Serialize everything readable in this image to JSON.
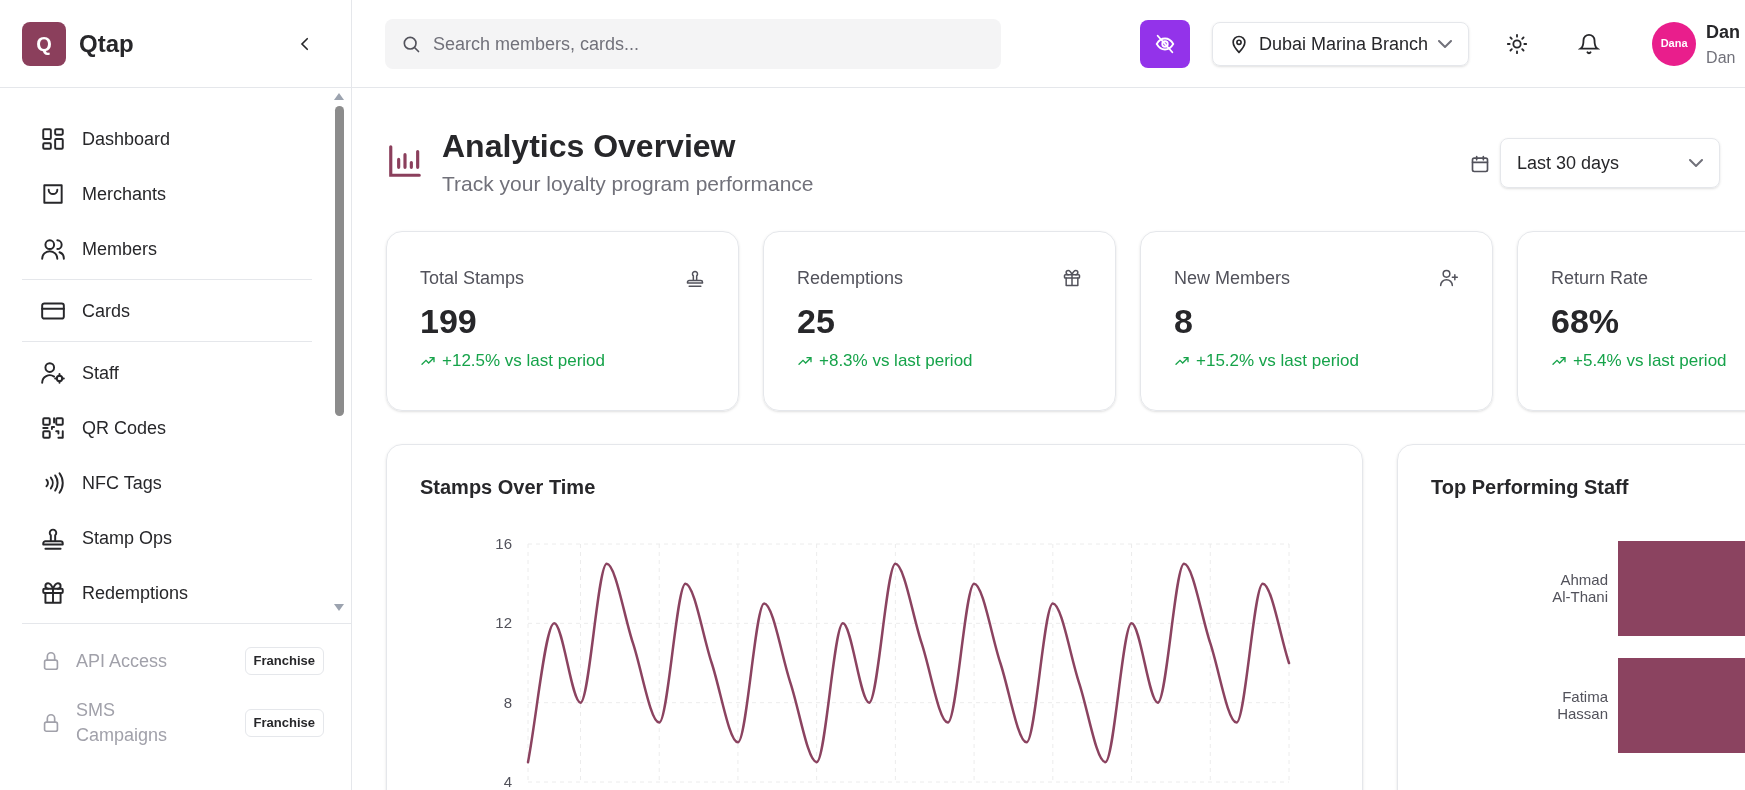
{
  "sidebar": {
    "logo_letter": "Q",
    "brand": "Qtap",
    "nav_groups": [
      [
        {
          "label": "Dashboard",
          "kind": "grid",
          "selected": false
        },
        {
          "label": "Merchants",
          "kind": "bag",
          "selected": false
        },
        {
          "label": "Members",
          "kind": "users",
          "selected": false
        }
      ],
      [
        {
          "label": "Cards",
          "kind": "card",
          "selected": false
        }
      ],
      [
        {
          "label": "Staff",
          "kind": "user-gear",
          "selected": false
        },
        {
          "label": "QR Codes",
          "kind": "qr",
          "selected": false
        },
        {
          "label": "NFC Tags",
          "kind": "nfc",
          "selected": false
        },
        {
          "label": "Stamp Ops",
          "kind": "stamp",
          "selected": false
        },
        {
          "label": "Redemptions",
          "kind": "gift",
          "selected": false
        }
      ]
    ],
    "locked_items": [
      {
        "label": "API Access",
        "badge": "Franchise",
        "locked": true
      },
      {
        "label": "SMS Campaigns",
        "badge": "Franchise",
        "locked": true
      }
    ]
  },
  "topbar": {
    "search_placeholder": "Search members, cards...",
    "branch": "Dubai Marina Branch",
    "avatar": "Dana",
    "user_name": "Dan",
    "user_subtitle": "Dan"
  },
  "header": {
    "title": "Analytics Overview",
    "subtitle": "Track your loyalty program performance",
    "date_range": "Last 30 days"
  },
  "stats": [
    {
      "label": "Total Stamps",
      "value": "199",
      "change": "+12.5% vs last period",
      "kind": "stamp"
    },
    {
      "label": "Redemptions",
      "value": "25",
      "change": "+8.3% vs last period",
      "kind": "gift"
    },
    {
      "label": "New Members",
      "value": "8",
      "change": "+15.2% vs last period",
      "kind": "user-plus"
    },
    {
      "label": "Return Rate",
      "value": "68%",
      "change": "+5.4% vs last period",
      "kind": "none"
    }
  ],
  "stamps_chart": {
    "title": "Stamps Over Time",
    "chart_data": {
      "type": "line",
      "grid": true,
      "ylim": [
        4,
        16
      ],
      "yticks": [
        4,
        8,
        12,
        16
      ],
      "series": [
        {
          "color": "#8b4360",
          "values": [
            5,
            12,
            8,
            15,
            11,
            7,
            14,
            10,
            6,
            13,
            9,
            5,
            12,
            8,
            15,
            11,
            7,
            14,
            10,
            6,
            13,
            9,
            5,
            12,
            8,
            15,
            11,
            7,
            14,
            10
          ]
        }
      ]
    }
  },
  "staff_chart": {
    "title": "Top Performing Staff",
    "staff": [
      {
        "name": "Ahmad Al-Thani"
      },
      {
        "name": "Fatima Hassan"
      }
    ]
  }
}
